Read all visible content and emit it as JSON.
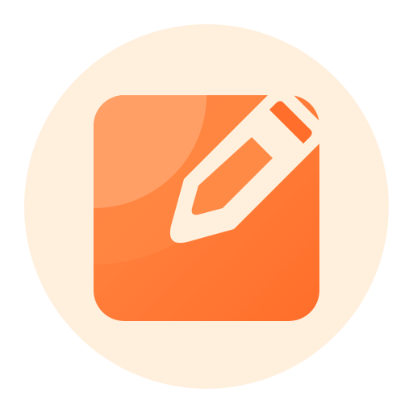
{
  "icon": {
    "name": "edit-icon",
    "colors": {
      "background_circle": "#FFF0DE",
      "square_light": "#FFA36C",
      "square_mid": "#FF8A46",
      "square_dark": "#FF6E2A",
      "pencil_outline": "#FFF0DE"
    }
  }
}
